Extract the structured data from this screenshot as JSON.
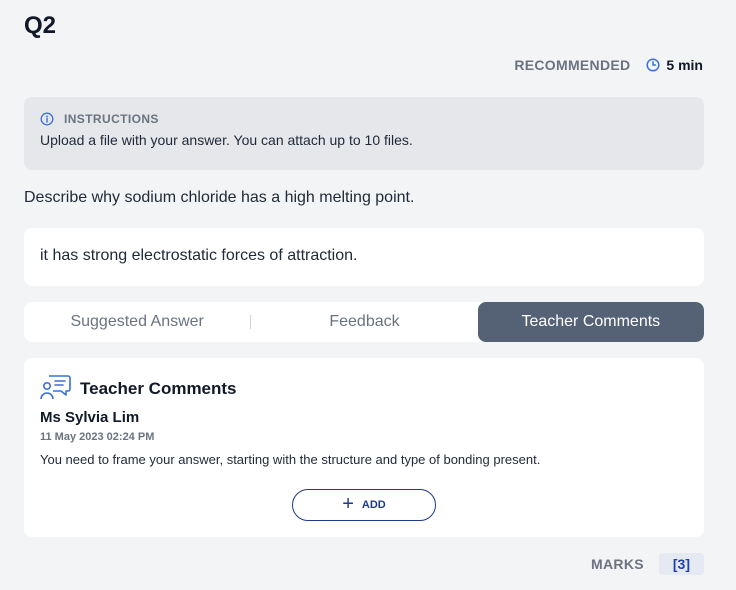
{
  "question": {
    "number": "Q2",
    "recommended_label": "RECOMMENDED",
    "recommended_time": "5 min",
    "instructions_title": "INSTRUCTIONS",
    "instructions_text": "Upload a file with your answer. You can attach up to 10 files.",
    "prompt": "Describe why sodium chloride has a high melting point.",
    "answer": "it has strong electrostatic forces of attraction."
  },
  "tabs": [
    {
      "label": "Suggested Answer",
      "active": false
    },
    {
      "label": "Feedback",
      "active": false
    },
    {
      "label": "Teacher Comments",
      "active": true
    }
  ],
  "comments": {
    "title": "Teacher Comments",
    "author": "Ms Sylvia Lim",
    "date": "11 May 2023 02:24 PM",
    "text": "You need to frame your answer, starting with the structure and type of bonding present.",
    "add_label": "ADD"
  },
  "marks": {
    "label": "MARKS",
    "value": "[3]"
  },
  "icons": {
    "recommended": "clock-icon",
    "instructions": "info-icon",
    "comments": "chat-bubbles-icon",
    "add": "plus-icon"
  },
  "colors": {
    "active_tab": "#556275",
    "accent": "#1e3a8a",
    "marks_bg": "#e5e9f2"
  }
}
